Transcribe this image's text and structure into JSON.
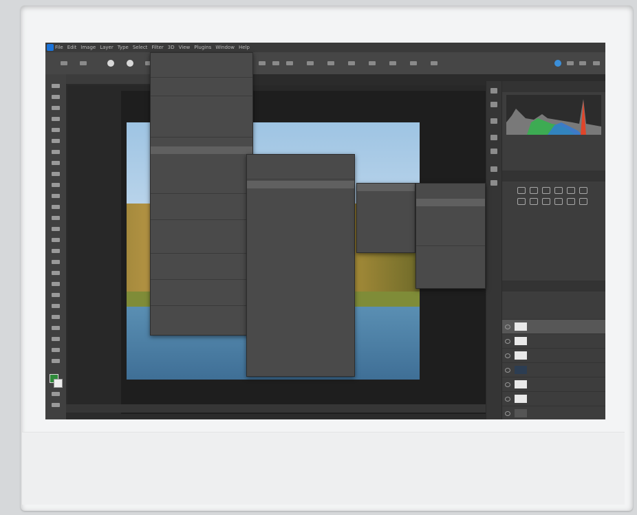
{
  "app": {
    "accent_color": "#1a73d9",
    "menubar": [
      "Ps",
      "File",
      "Edit",
      "Image",
      "Layer",
      "Type",
      "Select",
      "Filter",
      "3D",
      "View",
      "Plugins",
      "Window",
      "Help"
    ]
  },
  "document_tab": "",
  "statusbar": "",
  "panels": {
    "histogram_tab": "",
    "navigator_tab": "",
    "properties_tab": "",
    "adjustments_tab": "",
    "layers_tabs": [
      "",
      "",
      ""
    ],
    "layers": [
      {
        "name": "",
        "selected": true
      },
      {
        "name": ""
      },
      {
        "name": ""
      },
      {
        "name": ""
      },
      {
        "name": ""
      },
      {
        "name": ""
      },
      {
        "name": ""
      },
      {
        "name": ""
      },
      {
        "name": ""
      }
    ]
  },
  "menus": {
    "main_items": [
      "",
      "",
      "",
      "",
      "",
      "",
      "",
      "",
      "",
      "",
      "",
      "",
      "",
      "",
      "",
      "",
      "",
      "",
      "",
      "",
      "",
      "",
      "",
      "",
      "",
      "",
      "",
      "",
      "",
      "",
      "",
      "",
      "",
      ""
    ],
    "sub1_items": [
      "",
      "",
      "",
      "",
      "",
      "",
      "",
      "",
      "",
      "",
      "",
      "",
      "",
      "",
      "",
      "",
      "",
      "",
      "",
      "",
      "",
      "",
      "",
      "",
      "",
      "",
      "",
      ""
    ],
    "sub2_items": [
      "",
      "",
      "",
      "",
      "",
      "",
      "",
      "",
      "",
      ""
    ],
    "sub3_items": [
      "",
      "",
      "",
      "",
      "",
      "",
      "",
      "",
      "",
      "",
      "",
      ""
    ]
  }
}
